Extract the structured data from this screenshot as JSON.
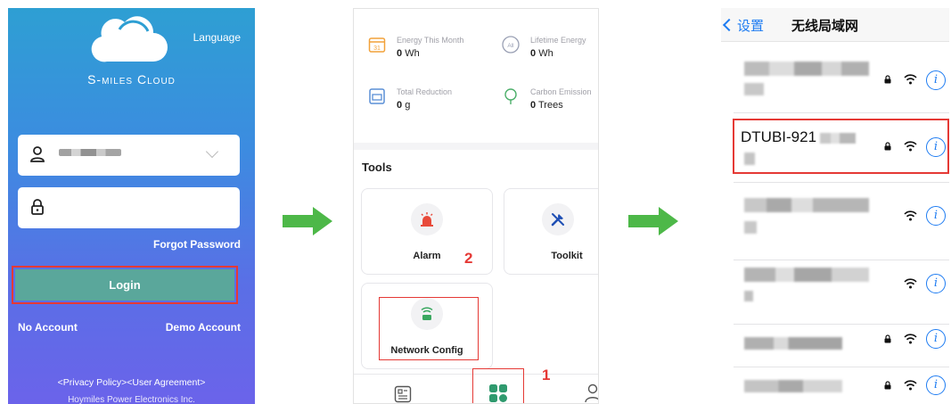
{
  "login": {
    "language": "Language",
    "brand": "S-miles Cloud",
    "forgot": "Forgot Password",
    "login_button": "Login",
    "no_account": "No Account",
    "demo_account": "Demo Account",
    "privacy": "<Privacy Policy><User Agreement>",
    "company": "Hoymiles Power Electronics Inc.",
    "colors": {
      "gradient_top": "#2e9fd3",
      "gradient_bottom": "#6b63ea",
      "login_button": "#5aa79b",
      "highlight": "#e53935"
    }
  },
  "stats": {
    "energy_month": {
      "label": "Energy This Month",
      "value": "0",
      "unit": "Wh",
      "icon": "calendar-icon"
    },
    "lifetime": {
      "label": "Lifetime Energy",
      "value": "0",
      "unit": "Wh",
      "icon": "all-icon"
    },
    "reduction": {
      "label": "Total Reduction",
      "value": "0",
      "unit": "g",
      "icon": "meter-icon"
    },
    "carbon": {
      "label": "Carbon Emission",
      "value": "0",
      "unit": "Trees",
      "icon": "tree-icon"
    }
  },
  "tools": {
    "title": "Tools",
    "items": [
      {
        "label": "Alarm",
        "icon": "alarm-icon"
      },
      {
        "label": "Toolkit",
        "icon": "toolkit-icon"
      },
      {
        "label": "Network Config",
        "icon": "router-wifi-icon"
      }
    ],
    "step_labels": {
      "tab": "1",
      "alarm_card": "2"
    }
  },
  "wifi": {
    "back": "设置",
    "title": "无线局域网",
    "selected_ssid": "DTUBI-921"
  }
}
